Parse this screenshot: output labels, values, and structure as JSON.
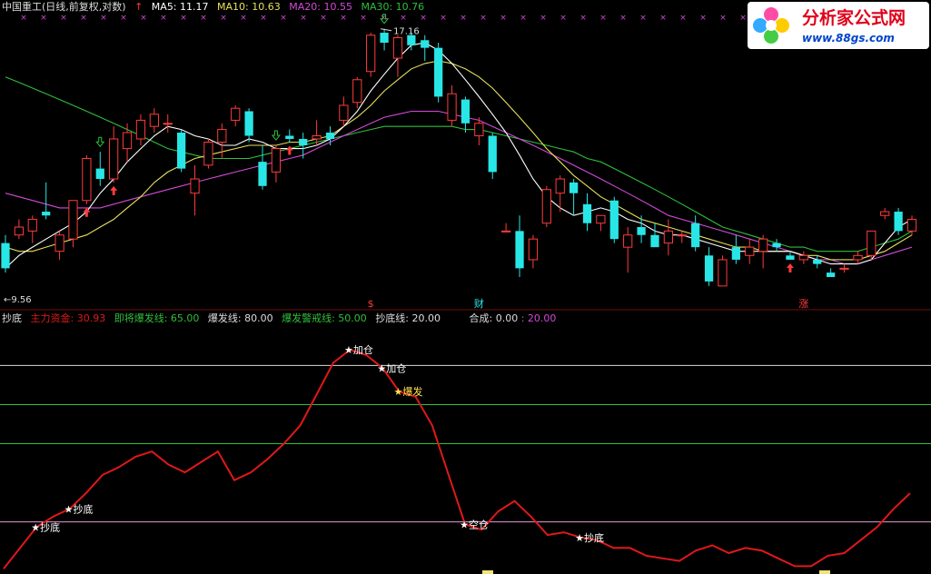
{
  "header": {
    "stock_title": "中国重工(日线,前复权,对数)",
    "ma5_label": "MA5: 11.17",
    "ma10_label": "MA10: 10.63",
    "ma20_label": "MA20: 10.55",
    "ma30_label": "MA30: 10.76"
  },
  "indicator_header": {
    "name": "抄底",
    "main_fund": "主力资金: 30.93",
    "pre_burst": "即将爆发线: 65.00",
    "burst": "爆发线: 80.00",
    "warn": "爆发警戒线: 50.00",
    "bottom": "抄底线: 20.00",
    "compose": "合成: 0.00",
    "compose2": ": 20.00"
  },
  "logo": {
    "title": "分析家公式网",
    "url": "www.88gs.com"
  },
  "colors": {
    "bg": "#000000",
    "up": "#ff3b3b",
    "down": "#29e6e6",
    "ma5": "#ffffff",
    "ma10": "#e6e05a",
    "ma20": "#d24ad8",
    "ma30": "#2fbf3a",
    "indicator": "#e01818",
    "marker": "#d24ad8"
  },
  "chart_data": [
    {
      "type": "candlestick",
      "title": "中国重工(日线,前复权,对数)",
      "scale": "log",
      "price_annotations": {
        "high_label": "17.16",
        "low_label": "9.56"
      },
      "candles": [
        {
          "o": 10.3,
          "h": 10.5,
          "l": 9.6,
          "c": 9.7
        },
        {
          "o": 10.5,
          "h": 10.9,
          "l": 10.4,
          "c": 10.7
        },
        {
          "o": 10.6,
          "h": 11.0,
          "l": 10.3,
          "c": 10.9
        },
        {
          "o": 11.1,
          "h": 11.9,
          "l": 10.9,
          "c": 11.0
        },
        {
          "o": 10.1,
          "h": 10.6,
          "l": 9.9,
          "c": 10.5
        },
        {
          "o": 10.4,
          "h": 11.4,
          "l": 10.2,
          "c": 11.4
        },
        {
          "o": 11.4,
          "h": 12.7,
          "l": 11.3,
          "c": 12.6
        },
        {
          "o": 12.3,
          "h": 12.8,
          "l": 11.8,
          "c": 12.0
        },
        {
          "o": 12.0,
          "h": 13.6,
          "l": 11.9,
          "c": 13.2
        },
        {
          "o": 12.9,
          "h": 13.7,
          "l": 12.5,
          "c": 13.4
        },
        {
          "o": 13.2,
          "h": 14.0,
          "l": 13.0,
          "c": 13.8
        },
        {
          "o": 13.6,
          "h": 14.2,
          "l": 13.4,
          "c": 14.0
        },
        {
          "o": 13.7,
          "h": 14.0,
          "l": 13.4,
          "c": 13.7
        },
        {
          "o": 13.4,
          "h": 13.5,
          "l": 12.2,
          "c": 12.3
        },
        {
          "o": 11.6,
          "h": 12.4,
          "l": 11.0,
          "c": 12.0
        },
        {
          "o": 12.4,
          "h": 13.2,
          "l": 12.3,
          "c": 13.1
        },
        {
          "o": 13.1,
          "h": 13.7,
          "l": 12.6,
          "c": 13.5
        },
        {
          "o": 13.8,
          "h": 14.3,
          "l": 13.6,
          "c": 14.2
        },
        {
          "o": 14.1,
          "h": 14.2,
          "l": 13.1,
          "c": 13.3
        },
        {
          "o": 12.5,
          "h": 13.0,
          "l": 11.7,
          "c": 11.8
        },
        {
          "o": 12.2,
          "h": 13.0,
          "l": 11.9,
          "c": 12.9
        },
        {
          "o": 13.3,
          "h": 13.5,
          "l": 13.1,
          "c": 13.2
        },
        {
          "o": 13.2,
          "h": 13.4,
          "l": 12.6,
          "c": 13.0
        },
        {
          "o": 13.2,
          "h": 13.8,
          "l": 13.0,
          "c": 13.3
        },
        {
          "o": 13.4,
          "h": 13.6,
          "l": 13.0,
          "c": 13.2
        },
        {
          "o": 13.8,
          "h": 14.6,
          "l": 13.6,
          "c": 14.3
        },
        {
          "o": 14.4,
          "h": 15.3,
          "l": 14.2,
          "c": 15.2
        },
        {
          "o": 15.5,
          "h": 17.0,
          "l": 15.3,
          "c": 16.9
        },
        {
          "o": 17.0,
          "h": 17.16,
          "l": 16.3,
          "c": 16.6
        },
        {
          "o": 16.0,
          "h": 16.9,
          "l": 15.3,
          "c": 16.8
        },
        {
          "o": 16.9,
          "h": 17.0,
          "l": 16.3,
          "c": 16.5
        },
        {
          "o": 16.7,
          "h": 16.9,
          "l": 15.9,
          "c": 16.4
        },
        {
          "o": 16.4,
          "h": 16.6,
          "l": 14.4,
          "c": 14.6
        },
        {
          "o": 13.8,
          "h": 15.0,
          "l": 13.6,
          "c": 14.7
        },
        {
          "o": 14.5,
          "h": 14.6,
          "l": 13.4,
          "c": 13.7
        },
        {
          "o": 13.3,
          "h": 13.9,
          "l": 13.0,
          "c": 13.7
        },
        {
          "o": 13.3,
          "h": 13.4,
          "l": 12.0,
          "c": 12.2
        },
        {
          "o": 10.6,
          "h": 10.8,
          "l": 10.6,
          "c": 10.6
        },
        {
          "o": 10.6,
          "h": 11.0,
          "l": 9.5,
          "c": 9.7
        },
        {
          "o": 9.9,
          "h": 10.5,
          "l": 9.7,
          "c": 10.4
        },
        {
          "o": 10.8,
          "h": 11.8,
          "l": 10.7,
          "c": 11.7
        },
        {
          "o": 11.6,
          "h": 12.1,
          "l": 11.1,
          "c": 12.0
        },
        {
          "o": 11.9,
          "h": 12.0,
          "l": 11.0,
          "c": 11.6
        },
        {
          "o": 11.3,
          "h": 11.6,
          "l": 10.6,
          "c": 10.8
        },
        {
          "o": 10.8,
          "h": 11.0,
          "l": 10.6,
          "c": 11.0
        },
        {
          "o": 11.4,
          "h": 11.5,
          "l": 10.3,
          "c": 10.4
        },
        {
          "o": 10.2,
          "h": 10.7,
          "l": 9.6,
          "c": 10.5
        },
        {
          "o": 10.7,
          "h": 11.0,
          "l": 10.3,
          "c": 10.5
        },
        {
          "o": 10.5,
          "h": 10.8,
          "l": 10.2,
          "c": 10.2
        },
        {
          "o": 10.3,
          "h": 10.9,
          "l": 10.0,
          "c": 10.6
        },
        {
          "o": 10.5,
          "h": 10.6,
          "l": 10.3,
          "c": 10.5
        },
        {
          "o": 10.8,
          "h": 11.0,
          "l": 10.1,
          "c": 10.2
        },
        {
          "o": 10.0,
          "h": 10.2,
          "l": 9.3,
          "c": 9.4
        },
        {
          "o": 9.3,
          "h": 10.0,
          "l": 9.3,
          "c": 9.9
        },
        {
          "o": 10.2,
          "h": 10.5,
          "l": 9.8,
          "c": 9.9
        },
        {
          "o": 10.0,
          "h": 10.4,
          "l": 9.8,
          "c": 10.2
        },
        {
          "o": 10.1,
          "h": 10.5,
          "l": 9.7,
          "c": 10.4
        },
        {
          "o": 10.3,
          "h": 10.4,
          "l": 10.1,
          "c": 10.2
        },
        {
          "o": 10.0,
          "h": 10.1,
          "l": 9.9,
          "c": 9.9
        },
        {
          "o": 9.9,
          "h": 10.1,
          "l": 9.8,
          "c": 10.0
        },
        {
          "o": 9.9,
          "h": 10.0,
          "l": 9.7,
          "c": 9.8
        },
        {
          "o": 9.6,
          "h": 9.7,
          "l": 9.5,
          "c": 9.5
        },
        {
          "o": 9.7,
          "h": 9.8,
          "l": 9.6,
          "c": 9.7
        },
        {
          "o": 9.9,
          "h": 10.1,
          "l": 9.8,
          "c": 10.0
        },
        {
          "o": 10.0,
          "h": 10.6,
          "l": 9.9,
          "c": 10.6
        },
        {
          "o": 11.0,
          "h": 11.2,
          "l": 10.9,
          "c": 11.1
        },
        {
          "o": 11.1,
          "h": 11.2,
          "l": 10.5,
          "c": 10.6
        },
        {
          "o": 10.6,
          "h": 11.0,
          "l": 10.5,
          "c": 10.9
        }
      ],
      "ma5": [
        9.7,
        10.0,
        10.2,
        10.4,
        10.6,
        10.8,
        11.1,
        11.6,
        12.0,
        12.5,
        12.9,
        13.3,
        13.6,
        13.5,
        13.3,
        13.2,
        13.0,
        13.0,
        13.2,
        13.1,
        12.9,
        12.9,
        12.9,
        13.0,
        13.2,
        13.6,
        14.1,
        14.8,
        15.4,
        16.0,
        16.5,
        16.6,
        16.3,
        15.8,
        15.2,
        14.6,
        14.0,
        13.4,
        12.7,
        12.0,
        11.5,
        11.2,
        11.0,
        11.1,
        11.2,
        11.1,
        10.9,
        10.8,
        10.6,
        10.5,
        10.5,
        10.4,
        10.3,
        10.2,
        10.1,
        10.1,
        10.1,
        10.1,
        10.1,
        10.0,
        9.9,
        9.8,
        9.8,
        9.8,
        9.9,
        10.3,
        10.7,
        10.9
      ],
      "ma10": [
        10.2,
        10.1,
        10.1,
        10.2,
        10.3,
        10.4,
        10.5,
        10.7,
        10.9,
        11.2,
        11.5,
        11.9,
        12.2,
        12.4,
        12.6,
        12.7,
        12.8,
        12.9,
        13.0,
        13.0,
        13.0,
        13.1,
        13.1,
        13.2,
        13.3,
        13.6,
        13.9,
        14.3,
        14.8,
        15.2,
        15.6,
        15.8,
        15.9,
        15.8,
        15.6,
        15.3,
        14.9,
        14.4,
        13.9,
        13.4,
        12.9,
        12.5,
        12.1,
        11.8,
        11.5,
        11.3,
        11.1,
        10.9,
        10.8,
        10.7,
        10.6,
        10.5,
        10.4,
        10.3,
        10.2,
        10.2,
        10.1,
        10.1,
        10.1,
        10.0,
        10.0,
        9.9,
        9.9,
        9.9,
        10.0,
        10.1,
        10.3,
        10.5
      ],
      "ma20": [
        11.6,
        11.5,
        11.4,
        11.3,
        11.2,
        11.2,
        11.2,
        11.2,
        11.3,
        11.4,
        11.5,
        11.6,
        11.7,
        11.8,
        11.9,
        12.0,
        12.1,
        12.2,
        12.3,
        12.4,
        12.5,
        12.6,
        12.7,
        12.9,
        13.1,
        13.3,
        13.5,
        13.7,
        13.9,
        14.0,
        14.1,
        14.1,
        14.1,
        14.0,
        13.9,
        13.8,
        13.6,
        13.4,
        13.2,
        13.0,
        12.8,
        12.6,
        12.4,
        12.2,
        12.0,
        11.8,
        11.6,
        11.4,
        11.2,
        11.0,
        10.9,
        10.8,
        10.7,
        10.6,
        10.5,
        10.4,
        10.3,
        10.2,
        10.1,
        10.0,
        9.9,
        9.9,
        9.8,
        9.8,
        9.9,
        10.0,
        10.1,
        10.2
      ],
      "ma30": [
        15.3,
        15.1,
        14.9,
        14.7,
        14.5,
        14.3,
        14.1,
        13.9,
        13.7,
        13.5,
        13.3,
        13.1,
        12.9,
        12.8,
        12.7,
        12.6,
        12.6,
        12.6,
        12.6,
        12.7,
        12.8,
        12.9,
        13.0,
        13.1,
        13.2,
        13.3,
        13.4,
        13.5,
        13.6,
        13.6,
        13.6,
        13.6,
        13.6,
        13.6,
        13.5,
        13.5,
        13.4,
        13.3,
        13.2,
        13.1,
        13.0,
        12.9,
        12.8,
        12.6,
        12.5,
        12.3,
        12.1,
        11.9,
        11.7,
        11.5,
        11.3,
        11.1,
        10.9,
        10.7,
        10.6,
        10.5,
        10.4,
        10.3,
        10.2,
        10.2,
        10.1,
        10.1,
        10.1,
        10.1,
        10.2,
        10.3,
        10.4,
        10.6
      ],
      "signals": {
        "buy_arrows": [
          6,
          8,
          21,
          58
        ],
        "down_arrows": [
          7,
          20,
          28
        ],
        "labels": [
          {
            "text": "$",
            "index": 27
          },
          {
            "text": "财",
            "index": 35
          },
          {
            "text": "涨",
            "index": 59
          }
        ]
      }
    },
    {
      "type": "line",
      "title": "抄底",
      "ylim": [
        0,
        100
      ],
      "lines": {
        "pre_burst": 65,
        "burst": 80,
        "warn": 50,
        "bottom": 20
      },
      "series": [
        {
          "name": "主力资金",
          "values": [
            2,
            10,
            18,
            22,
            25,
            31,
            38,
            41,
            45,
            47,
            42,
            39,
            43,
            47,
            36,
            39,
            44,
            50,
            57,
            69,
            81,
            86,
            84,
            79,
            70,
            68,
            57,
            38,
            19,
            17,
            24,
            28,
            22,
            15,
            16,
            14,
            13,
            10,
            10,
            7,
            6,
            5,
            9,
            11,
            8,
            10,
            9,
            6,
            3,
            3,
            7,
            8,
            13,
            18,
            25,
            31
          ]
        }
      ],
      "annotations": [
        {
          "text": "抄底",
          "index": 2
        },
        {
          "text": "抄底",
          "index": 4
        },
        {
          "text": "加仓",
          "index": 21
        },
        {
          "text": "加仓",
          "index": 23
        },
        {
          "text": "爆发",
          "index": 24
        },
        {
          "text": "空仓",
          "index": 28
        },
        {
          "text": "抄底",
          "index": 35
        },
        {
          "text": "抄底",
          "index": 61
        }
      ]
    }
  ]
}
